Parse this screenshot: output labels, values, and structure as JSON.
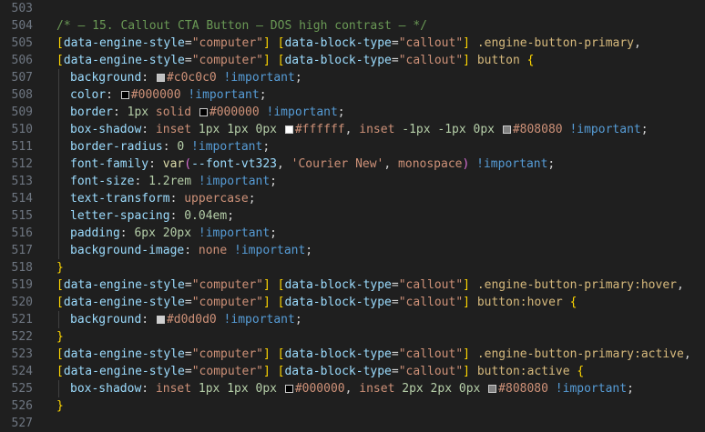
{
  "lines": [
    {
      "n": "503",
      "tokens": []
    },
    {
      "n": "504",
      "tokens": [
        {
          "t": "/* — 15. Callout CTA Button — DOS high contrast — */",
          "c": "comment"
        }
      ]
    },
    {
      "n": "505",
      "tokens": [
        {
          "t": "[",
          "c": "bracket"
        },
        {
          "t": "data-engine-style",
          "c": "attr"
        },
        {
          "t": "=",
          "c": "plain"
        },
        {
          "t": "\"computer\"",
          "c": "str"
        },
        {
          "t": "]",
          "c": "bracket"
        },
        {
          "t": " ",
          "c": "plain"
        },
        {
          "t": "[",
          "c": "bracket"
        },
        {
          "t": "data-block-type",
          "c": "attr"
        },
        {
          "t": "=",
          "c": "plain"
        },
        {
          "t": "\"callout\"",
          "c": "str"
        },
        {
          "t": "]",
          "c": "bracket"
        },
        {
          "t": " .engine-button-primary",
          "c": "sel"
        },
        {
          "t": ",",
          "c": "plain"
        }
      ]
    },
    {
      "n": "506",
      "tokens": [
        {
          "t": "[",
          "c": "bracket"
        },
        {
          "t": "data-engine-style",
          "c": "attr"
        },
        {
          "t": "=",
          "c": "plain"
        },
        {
          "t": "\"computer\"",
          "c": "str"
        },
        {
          "t": "]",
          "c": "bracket"
        },
        {
          "t": " ",
          "c": "plain"
        },
        {
          "t": "[",
          "c": "bracket"
        },
        {
          "t": "data-block-type",
          "c": "attr"
        },
        {
          "t": "=",
          "c": "plain"
        },
        {
          "t": "\"callout\"",
          "c": "str"
        },
        {
          "t": "]",
          "c": "bracket"
        },
        {
          "t": " button",
          "c": "tag"
        },
        {
          "t": " ",
          "c": "plain"
        },
        {
          "t": "{",
          "c": "bracket"
        }
      ]
    },
    {
      "n": "507",
      "indent": true,
      "tokens": [
        {
          "t": "background",
          "c": "prop"
        },
        {
          "t": ": ",
          "c": "plain"
        },
        {
          "sw": "#c0c0c0"
        },
        {
          "t": "#c0c0c0",
          "c": "val"
        },
        {
          "t": " !important",
          "c": "imp"
        },
        {
          "t": ";",
          "c": "plain"
        }
      ]
    },
    {
      "n": "508",
      "indent": true,
      "tokens": [
        {
          "t": "color",
          "c": "prop"
        },
        {
          "t": ": ",
          "c": "plain"
        },
        {
          "sw": "#000000"
        },
        {
          "t": "#000000",
          "c": "val"
        },
        {
          "t": " !important",
          "c": "imp"
        },
        {
          "t": ";",
          "c": "plain"
        }
      ]
    },
    {
      "n": "509",
      "indent": true,
      "tokens": [
        {
          "t": "border",
          "c": "prop"
        },
        {
          "t": ": ",
          "c": "plain"
        },
        {
          "t": "1px",
          "c": "num"
        },
        {
          "t": " solid ",
          "c": "val"
        },
        {
          "sw": "#000000"
        },
        {
          "t": "#000000",
          "c": "val"
        },
        {
          "t": " !important",
          "c": "imp"
        },
        {
          "t": ";",
          "c": "plain"
        }
      ]
    },
    {
      "n": "510",
      "indent": true,
      "tokens": [
        {
          "t": "box-shadow",
          "c": "prop"
        },
        {
          "t": ": ",
          "c": "plain"
        },
        {
          "t": "inset ",
          "c": "val"
        },
        {
          "t": "1px 1px 0px ",
          "c": "num"
        },
        {
          "sw": "#ffffff"
        },
        {
          "t": "#ffffff",
          "c": "val"
        },
        {
          "t": ", ",
          "c": "plain"
        },
        {
          "t": "inset ",
          "c": "val"
        },
        {
          "t": "-1px -1px 0px ",
          "c": "num"
        },
        {
          "sw": "#808080"
        },
        {
          "t": "#808080",
          "c": "val"
        },
        {
          "t": " !important",
          "c": "imp"
        },
        {
          "t": ";",
          "c": "plain"
        }
      ]
    },
    {
      "n": "511",
      "indent": true,
      "tokens": [
        {
          "t": "border-radius",
          "c": "prop"
        },
        {
          "t": ": ",
          "c": "plain"
        },
        {
          "t": "0",
          "c": "num"
        },
        {
          "t": " !important",
          "c": "imp"
        },
        {
          "t": ";",
          "c": "plain"
        }
      ]
    },
    {
      "n": "512",
      "indent": true,
      "tokens": [
        {
          "t": "font-family",
          "c": "prop"
        },
        {
          "t": ": ",
          "c": "plain"
        },
        {
          "t": "var",
          "c": "fn"
        },
        {
          "t": "(",
          "c": "paren"
        },
        {
          "t": "--font-vt323",
          "c": "attr"
        },
        {
          "t": ", ",
          "c": "plain"
        },
        {
          "t": "'Courier New'",
          "c": "str"
        },
        {
          "t": ", ",
          "c": "plain"
        },
        {
          "t": "monospace",
          "c": "val"
        },
        {
          "t": ")",
          "c": "paren"
        },
        {
          "t": " !important",
          "c": "imp"
        },
        {
          "t": ";",
          "c": "plain"
        }
      ]
    },
    {
      "n": "513",
      "indent": true,
      "tokens": [
        {
          "t": "font-size",
          "c": "prop"
        },
        {
          "t": ": ",
          "c": "plain"
        },
        {
          "t": "1.2rem",
          "c": "num"
        },
        {
          "t": " !important",
          "c": "imp"
        },
        {
          "t": ";",
          "c": "plain"
        }
      ]
    },
    {
      "n": "514",
      "indent": true,
      "tokens": [
        {
          "t": "text-transform",
          "c": "prop"
        },
        {
          "t": ": ",
          "c": "plain"
        },
        {
          "t": "uppercase",
          "c": "val"
        },
        {
          "t": ";",
          "c": "plain"
        }
      ]
    },
    {
      "n": "515",
      "indent": true,
      "tokens": [
        {
          "t": "letter-spacing",
          "c": "prop"
        },
        {
          "t": ": ",
          "c": "plain"
        },
        {
          "t": "0.04em",
          "c": "num"
        },
        {
          "t": ";",
          "c": "plain"
        }
      ]
    },
    {
      "n": "516",
      "indent": true,
      "tokens": [
        {
          "t": "padding",
          "c": "prop"
        },
        {
          "t": ": ",
          "c": "plain"
        },
        {
          "t": "6px 20px",
          "c": "num"
        },
        {
          "t": " !important",
          "c": "imp"
        },
        {
          "t": ";",
          "c": "plain"
        }
      ]
    },
    {
      "n": "517",
      "indent": true,
      "tokens": [
        {
          "t": "background-image",
          "c": "prop"
        },
        {
          "t": ": ",
          "c": "plain"
        },
        {
          "t": "none",
          "c": "val"
        },
        {
          "t": " !important",
          "c": "imp"
        },
        {
          "t": ";",
          "c": "plain"
        }
      ]
    },
    {
      "n": "518",
      "tokens": [
        {
          "t": "}",
          "c": "bracket"
        }
      ]
    },
    {
      "n": "519",
      "tokens": [
        {
          "t": "[",
          "c": "bracket"
        },
        {
          "t": "data-engine-style",
          "c": "attr"
        },
        {
          "t": "=",
          "c": "plain"
        },
        {
          "t": "\"computer\"",
          "c": "str"
        },
        {
          "t": "]",
          "c": "bracket"
        },
        {
          "t": " ",
          "c": "plain"
        },
        {
          "t": "[",
          "c": "bracket"
        },
        {
          "t": "data-block-type",
          "c": "attr"
        },
        {
          "t": "=",
          "c": "plain"
        },
        {
          "t": "\"callout\"",
          "c": "str"
        },
        {
          "t": "]",
          "c": "bracket"
        },
        {
          "t": " .engine-button-primary:hover",
          "c": "sel"
        },
        {
          "t": ",",
          "c": "plain"
        }
      ]
    },
    {
      "n": "520",
      "tokens": [
        {
          "t": "[",
          "c": "bracket"
        },
        {
          "t": "data-engine-style",
          "c": "attr"
        },
        {
          "t": "=",
          "c": "plain"
        },
        {
          "t": "\"computer\"",
          "c": "str"
        },
        {
          "t": "]",
          "c": "bracket"
        },
        {
          "t": " ",
          "c": "plain"
        },
        {
          "t": "[",
          "c": "bracket"
        },
        {
          "t": "data-block-type",
          "c": "attr"
        },
        {
          "t": "=",
          "c": "plain"
        },
        {
          "t": "\"callout\"",
          "c": "str"
        },
        {
          "t": "]",
          "c": "bracket"
        },
        {
          "t": " button:hover",
          "c": "tag"
        },
        {
          "t": " ",
          "c": "plain"
        },
        {
          "t": "{",
          "c": "bracket"
        }
      ]
    },
    {
      "n": "521",
      "indent": true,
      "tokens": [
        {
          "t": "background",
          "c": "prop"
        },
        {
          "t": ": ",
          "c": "plain"
        },
        {
          "sw": "#d0d0d0"
        },
        {
          "t": "#d0d0d0",
          "c": "val"
        },
        {
          "t": " !important",
          "c": "imp"
        },
        {
          "t": ";",
          "c": "plain"
        }
      ]
    },
    {
      "n": "522",
      "tokens": [
        {
          "t": "}",
          "c": "bracket"
        }
      ]
    },
    {
      "n": "523",
      "tokens": [
        {
          "t": "[",
          "c": "bracket"
        },
        {
          "t": "data-engine-style",
          "c": "attr"
        },
        {
          "t": "=",
          "c": "plain"
        },
        {
          "t": "\"computer\"",
          "c": "str"
        },
        {
          "t": "]",
          "c": "bracket"
        },
        {
          "t": " ",
          "c": "plain"
        },
        {
          "t": "[",
          "c": "bracket"
        },
        {
          "t": "data-block-type",
          "c": "attr"
        },
        {
          "t": "=",
          "c": "plain"
        },
        {
          "t": "\"callout\"",
          "c": "str"
        },
        {
          "t": "]",
          "c": "bracket"
        },
        {
          "t": " .engine-button-primary:active",
          "c": "sel"
        },
        {
          "t": ",",
          "c": "plain"
        }
      ]
    },
    {
      "n": "524",
      "tokens": [
        {
          "t": "[",
          "c": "bracket"
        },
        {
          "t": "data-engine-style",
          "c": "attr"
        },
        {
          "t": "=",
          "c": "plain"
        },
        {
          "t": "\"computer\"",
          "c": "str"
        },
        {
          "t": "]",
          "c": "bracket"
        },
        {
          "t": " ",
          "c": "plain"
        },
        {
          "t": "[",
          "c": "bracket"
        },
        {
          "t": "data-block-type",
          "c": "attr"
        },
        {
          "t": "=",
          "c": "plain"
        },
        {
          "t": "\"callout\"",
          "c": "str"
        },
        {
          "t": "]",
          "c": "bracket"
        },
        {
          "t": " button:active",
          "c": "tag"
        },
        {
          "t": " ",
          "c": "plain"
        },
        {
          "t": "{",
          "c": "bracket"
        }
      ]
    },
    {
      "n": "525",
      "indent": true,
      "tokens": [
        {
          "t": "box-shadow",
          "c": "prop"
        },
        {
          "t": ": ",
          "c": "plain"
        },
        {
          "t": "inset ",
          "c": "val"
        },
        {
          "t": "1px 1px 0px ",
          "c": "num"
        },
        {
          "sw": "#000000"
        },
        {
          "t": "#000000",
          "c": "val"
        },
        {
          "t": ", ",
          "c": "plain"
        },
        {
          "t": "inset ",
          "c": "val"
        },
        {
          "t": "2px 2px 0px ",
          "c": "num"
        },
        {
          "sw": "#808080"
        },
        {
          "t": "#808080",
          "c": "val"
        },
        {
          "t": " !important",
          "c": "imp"
        },
        {
          "t": ";",
          "c": "plain"
        }
      ]
    },
    {
      "n": "526",
      "tokens": [
        {
          "t": "}",
          "c": "bracket"
        }
      ]
    },
    {
      "n": "527",
      "tokens": []
    }
  ]
}
